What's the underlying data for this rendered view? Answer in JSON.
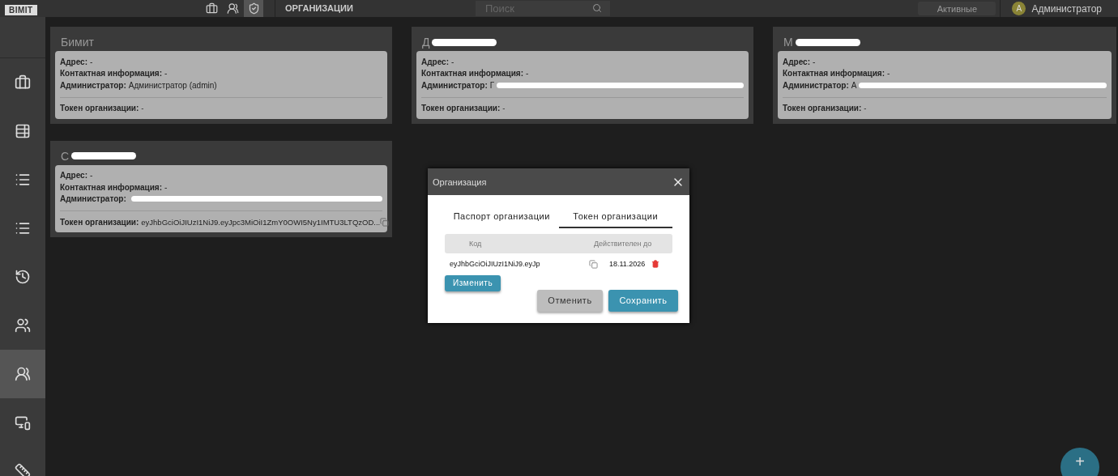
{
  "topbar": {
    "logo": "BIMIT",
    "tools": [
      {
        "selected": false,
        "kind": "briefcase"
      },
      {
        "selected": false,
        "kind": "group"
      },
      {
        "selected": true,
        "kind": "shield"
      }
    ],
    "section_title": "ОРГАНИЗАЦИИ",
    "search": {
      "placeholder": "Поиск"
    },
    "filter_button": "Активные",
    "user": {
      "initial": "A",
      "name": "Администратор"
    }
  },
  "sidebar": {
    "items": [
      {
        "kind": "briefcase",
        "selected": false
      },
      {
        "kind": "table",
        "selected": false
      },
      {
        "kind": "list",
        "selected": false
      },
      {
        "kind": "list",
        "selected": false
      },
      {
        "kind": "history",
        "selected": false
      },
      {
        "kind": "people",
        "selected": false
      },
      {
        "kind": "group",
        "selected": true
      },
      {
        "kind": "devices",
        "selected": false
      },
      {
        "kind": "ruler",
        "selected": false
      }
    ]
  },
  "organizations": [
    {
      "title": "Бимит",
      "title_redacted": false,
      "address_label": "Адрес:",
      "address": "-",
      "contact_label": "Контактная информация:",
      "contact": "-",
      "admin_label": "Администратор:",
      "admin": "Администратор (admin)",
      "admin_redacted": false,
      "token_label": "Токен организации:",
      "token": "-",
      "copyable": false
    },
    {
      "title": "Д",
      "title_redacted": true,
      "address_label": "Адрес:",
      "address": "-",
      "contact_label": "Контактная информация:",
      "contact": "-",
      "admin_label": "Администратор:",
      "admin": "Г",
      "admin_redacted": true,
      "token_label": "Токен организации:",
      "token": "-",
      "copyable": false
    },
    {
      "title": "М",
      "title_redacted": true,
      "address_label": "Адрес:",
      "address": "-",
      "contact_label": "Контактная информация:",
      "contact": "-",
      "admin_label": "Администратор:",
      "admin": "А",
      "admin_redacted": true,
      "token_label": "Токен организации:",
      "token": "-",
      "copyable": false
    },
    {
      "title": "С",
      "title_redacted": true,
      "address_label": "Адрес:",
      "address": "-",
      "contact_label": "Контактная информация:",
      "contact": "-",
      "admin_label": "Администратор:",
      "admin_redacted": true,
      "token_label": "Токен организации:",
      "token": "eyJhbGciOiJIUzI1NiJ9.eyJpc3MiOiI1ZmY0OWI5Ny1IMTU3LTQzOD...",
      "copyable": true
    }
  ],
  "dialog": {
    "title": "Организация",
    "tabs": [
      {
        "label": "Паспорт организации",
        "selected": false
      },
      {
        "label": "Токен организации",
        "selected": true
      }
    ],
    "table": {
      "columns": [
        "Код",
        "Действителен до"
      ],
      "rows": [
        {
          "code": "eyJhbGciOiJIUzI1NiJ9.eyJp",
          "valid_until": "18.11.2026"
        }
      ]
    },
    "change_button": "Изменить",
    "cancel_button": "Отменить",
    "save_button": "Сохранить"
  },
  "fab": {
    "label": "+"
  }
}
